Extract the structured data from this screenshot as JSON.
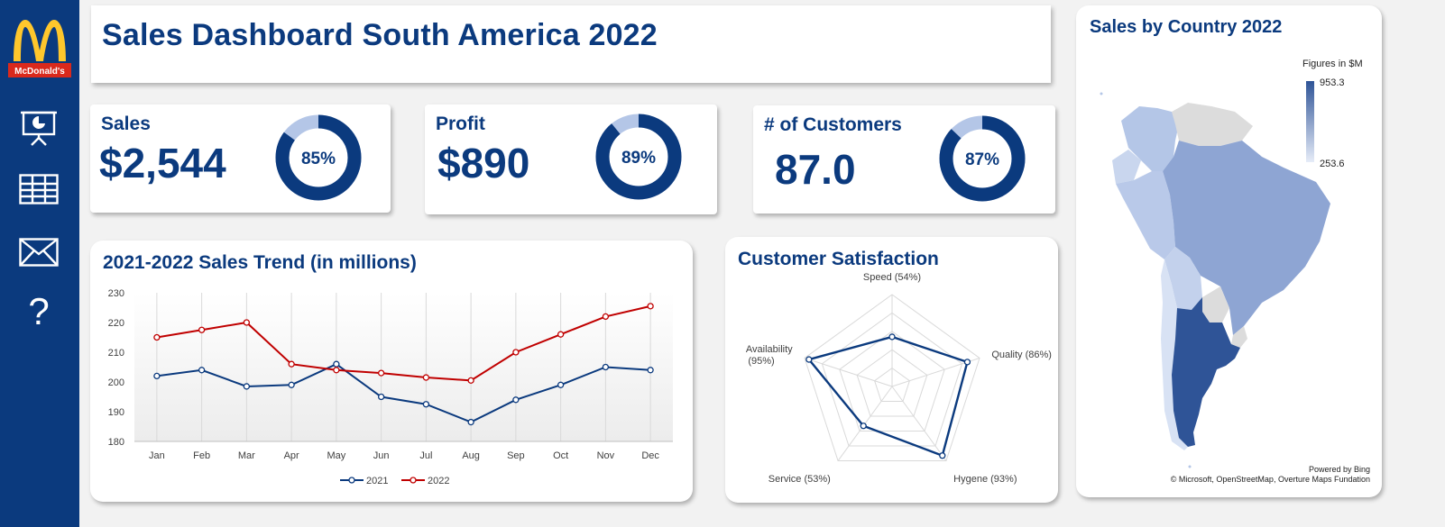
{
  "brand": {
    "logo_text": "McDonald's"
  },
  "sidebar": {
    "items": [
      {
        "icon": "presentation-icon"
      },
      {
        "icon": "table-icon"
      },
      {
        "icon": "mail-icon"
      },
      {
        "icon": "help-icon",
        "label": "?"
      }
    ]
  },
  "header": {
    "title": "Sales Dashboard South America 2022"
  },
  "kpis": {
    "sales": {
      "label": "Sales",
      "value": "$2,544",
      "percent": 85,
      "percent_label": "85%"
    },
    "profit": {
      "label": "Profit",
      "value": "$890",
      "percent": 89,
      "percent_label": "89%"
    },
    "customers": {
      "label": "# of Customers",
      "value": "87.0",
      "percent": 87,
      "percent_label": "87%"
    }
  },
  "colors": {
    "primary": "#0b3a7e",
    "light": "#b4c6e7",
    "red": "#c00000",
    "sidebar": "#0b3a7e",
    "logo_red": "#da291c",
    "logo_yellow": "#ffc72c"
  },
  "trend": {
    "title": "2021-2022 Sales Trend (in millions)",
    "chart_data": {
      "type": "line",
      "categories": [
        "Jan",
        "Feb",
        "Mar",
        "Apr",
        "May",
        "Jun",
        "Jul",
        "Aug",
        "Sep",
        "Oct",
        "Nov",
        "Dec"
      ],
      "series": [
        {
          "name": "2021",
          "color": "#0b3a7e",
          "values": [
            202,
            204,
            198.5,
            199,
            206,
            195,
            192.5,
            186.5,
            194,
            199,
            205,
            204
          ]
        },
        {
          "name": "2022",
          "color": "#c00000",
          "values": [
            215,
            217.5,
            220,
            206,
            204,
            203,
            201.5,
            200.5,
            210,
            216,
            222,
            225.5
          ]
        }
      ],
      "ylim": [
        180,
        230
      ],
      "yticks": [
        180,
        190,
        200,
        210,
        220,
        230
      ],
      "xlabel": "",
      "ylabel": "",
      "legend": "bottom",
      "grid": "vertical"
    }
  },
  "satisfaction": {
    "title": "Customer Satisfaction",
    "chart_data": {
      "type": "radar",
      "categories": [
        "Speed (54%)",
        "Quality (86%)",
        "Hygene (93%)",
        "Service (53%)",
        "Availability (95%)"
      ],
      "values": [
        54,
        86,
        93,
        53,
        95
      ],
      "rmax": 100
    }
  },
  "map": {
    "title": "Sales by Country 2022",
    "legend_title": "Figures in $M",
    "legend_max": "953.3",
    "legend_min": "253.6",
    "credit_1": "Powered by Bing",
    "credit_2": "© Microsoft, OpenStreetMap, Overture Maps Fundation"
  }
}
